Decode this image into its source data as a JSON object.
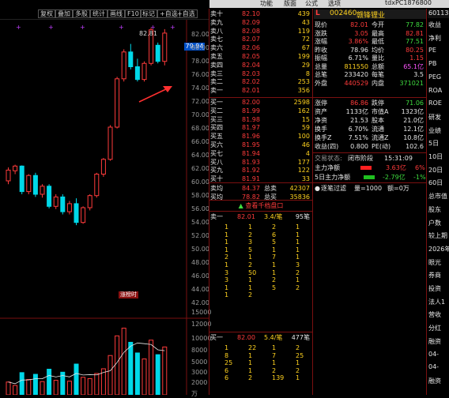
{
  "menubar": {
    "items": [
      "功能",
      "版面",
      "公式",
      "选项"
    ],
    "session": "tdxPC1876800"
  },
  "toolbar": {
    "items": [
      "复权",
      "叠加",
      "多股",
      "统计",
      "画线",
      "F10",
      "标记",
      "+自选"
    ]
  },
  "stock": {
    "code": "002460",
    "name": "赣锋锂业",
    "badge": "L",
    "right_code": "60113"
  },
  "price_axis": [
    "82.00",
    "80.00",
    "78.00",
    "76.00",
    "74.00",
    "72.00",
    "70.00",
    "68.00",
    "66.00",
    "64.00",
    "62.00",
    "60.00",
    "58.00",
    "56.00",
    "54.00",
    "52.00",
    "50.00",
    "48.00",
    "46.00",
    "44.00",
    "42.00"
  ],
  "current_price_tag": "79.94",
  "high_label": "82.81",
  "event_label": "涨榜时",
  "volume_axis": [
    "15000",
    "12000",
    "10000",
    "8000",
    "5000",
    "3000",
    "2000",
    "万"
  ],
  "asks": [
    {
      "label": "卖十",
      "price": "82.10",
      "vol": "439"
    },
    {
      "label": "卖九",
      "price": "82.09",
      "vol": "43"
    },
    {
      "label": "卖八",
      "price": "82.08",
      "vol": "119"
    },
    {
      "label": "卖七",
      "price": "82.07",
      "vol": "72"
    },
    {
      "label": "卖六",
      "price": "82.06",
      "vol": "67"
    },
    {
      "label": "卖五",
      "price": "82.05",
      "vol": "199"
    },
    {
      "label": "卖四",
      "price": "82.04",
      "vol": "29"
    },
    {
      "label": "卖三",
      "price": "82.03",
      "vol": "8"
    },
    {
      "label": "卖二",
      "price": "82.02",
      "vol": "253"
    },
    {
      "label": "卖一",
      "price": "82.01",
      "vol": "356"
    }
  ],
  "bids": [
    {
      "label": "买一",
      "price": "82.00",
      "vol": "2598"
    },
    {
      "label": "买二",
      "price": "81.99",
      "vol": "162"
    },
    {
      "label": "买三",
      "price": "81.98",
      "vol": "15"
    },
    {
      "label": "买四",
      "price": "81.97",
      "vol": "59"
    },
    {
      "label": "买五",
      "price": "81.96",
      "vol": "100"
    },
    {
      "label": "买六",
      "price": "81.95",
      "vol": "46"
    },
    {
      "label": "买七",
      "price": "81.94",
      "vol": "4"
    },
    {
      "label": "买八",
      "price": "81.93",
      "vol": "177"
    },
    {
      "label": "买九",
      "price": "81.92",
      "vol": "122"
    },
    {
      "label": "买十",
      "price": "81.91",
      "vol": "33"
    }
  ],
  "avg_rows": [
    {
      "l1": "卖均",
      "v1": "84.37",
      "l2": "总卖",
      "v2": "42307"
    },
    {
      "l1": "买均",
      "v1": "78.82",
      "l2": "总买",
      "v2": "35836"
    }
  ],
  "view_thousand_label": "查看千档盘口",
  "level_sell": {
    "label": "卖一",
    "price": "82.01",
    "ratio": "3.4/笔",
    "count": "95笔",
    "grid": [
      [
        "1",
        "1",
        "2",
        "1"
      ],
      [
        "1",
        "2",
        "6",
        "1"
      ],
      [
        "1",
        "3",
        "5",
        "1"
      ],
      [
        "1",
        "5",
        "1",
        "1"
      ],
      [
        "2",
        "1",
        "7",
        "1"
      ],
      [
        "1",
        "2",
        "1",
        "3"
      ],
      [
        "3",
        "50",
        "1",
        "2"
      ],
      [
        "3",
        "1",
        "2",
        "1"
      ],
      [
        "1",
        "1",
        "5",
        "2"
      ],
      [
        "1",
        "2",
        "",
        ""
      ]
    ]
  },
  "level_buy": {
    "label": "买一",
    "price": "82.00",
    "ratio": "5.4/笔",
    "count": "477笔",
    "grid": [
      [
        "1",
        "22",
        "1",
        "2"
      ],
      [
        "8",
        "1",
        "7",
        "25"
      ],
      [
        "25",
        "1",
        "1",
        "1"
      ],
      [
        "6",
        "1",
        "2",
        "2"
      ],
      [
        "6",
        "2",
        "139",
        "1"
      ]
    ]
  },
  "quote": [
    {
      "l1": "现价",
      "v1": "82.01",
      "c1": "red",
      "l2": "今开",
      "v2": "77.82",
      "c2": "grn"
    },
    {
      "l1": "涨跌",
      "v1": "3.05",
      "c1": "red",
      "l2": "最高",
      "v2": "82.81",
      "c2": "red"
    },
    {
      "l1": "涨幅",
      "v1": "3.86%",
      "c1": "red",
      "l2": "最低",
      "v2": "77.51",
      "c2": "grn"
    },
    {
      "l1": "昨收",
      "v1": "78.96",
      "c1": "wht",
      "l2": "均价",
      "v2": "80.25",
      "c2": "red"
    },
    {
      "l1": "振幅",
      "v1": "6.71%",
      "c1": "wht",
      "l2": "量比",
      "v2": "1.15",
      "c2": "red"
    },
    {
      "l1": "总量",
      "v1": "811550",
      "c1": "yel",
      "l2": "总额",
      "v2": "65.1亿",
      "c2": "mag"
    },
    {
      "l1": "总笔",
      "v1": "233420",
      "c1": "wht",
      "l2": "每笔",
      "v2": "3.5",
      "c2": "wht"
    },
    {
      "l1": "外盘",
      "v1": "440529",
      "c1": "red",
      "l2": "内盘",
      "v2": "371021",
      "c2": "grn"
    }
  ],
  "fundamentals": [
    {
      "l1": "涨停",
      "v1": "86.86",
      "l2": "跌停",
      "v2": "71.06"
    },
    {
      "l1": "资产",
      "v1": "1133亿",
      "l2": "市值A",
      "v2": "1323亿"
    },
    {
      "l1": "净资",
      "v1": "21.53",
      "l2": "股本",
      "v2": "21.0亿"
    },
    {
      "l1": "换手",
      "v1": "6.70%",
      "l2": "流通",
      "v2": "12.1亿"
    },
    {
      "l1": "换手Z",
      "v1": "7.51%",
      "l2": "流通Z",
      "v2": "10.8亿"
    },
    {
      "l1": "收益(四)",
      "v1": "0.800",
      "l2": "PE(动)",
      "v2": "102.6"
    }
  ],
  "trade_status": {
    "label": "交易状态:",
    "value": "闭市阶段",
    "time": "15:31:09"
  },
  "main_net": {
    "label": "主力净额",
    "value": "3.63亿",
    "pct": "6%"
  },
  "main_net5": {
    "label": "5日主力净额",
    "value": "-2.79亿",
    "pct": "-1%"
  },
  "filter_bar": {
    "label": "逐笔过滤",
    "mode": "量=1000",
    "unit": "额=0万"
  },
  "side_panel": [
    "收益",
    "净利",
    "PE",
    "PB",
    "PEG",
    "ROA",
    "ROE",
    "研发",
    "业绩",
    "5日",
    "10日",
    "20日",
    "60日",
    "总市值",
    "股东",
    "户数",
    "较上期",
    "2026年",
    "眼光",
    "券商",
    "投资",
    "法人1",
    "营收",
    "分红",
    "融资",
    "04-",
    "04-",
    "融资"
  ]
}
